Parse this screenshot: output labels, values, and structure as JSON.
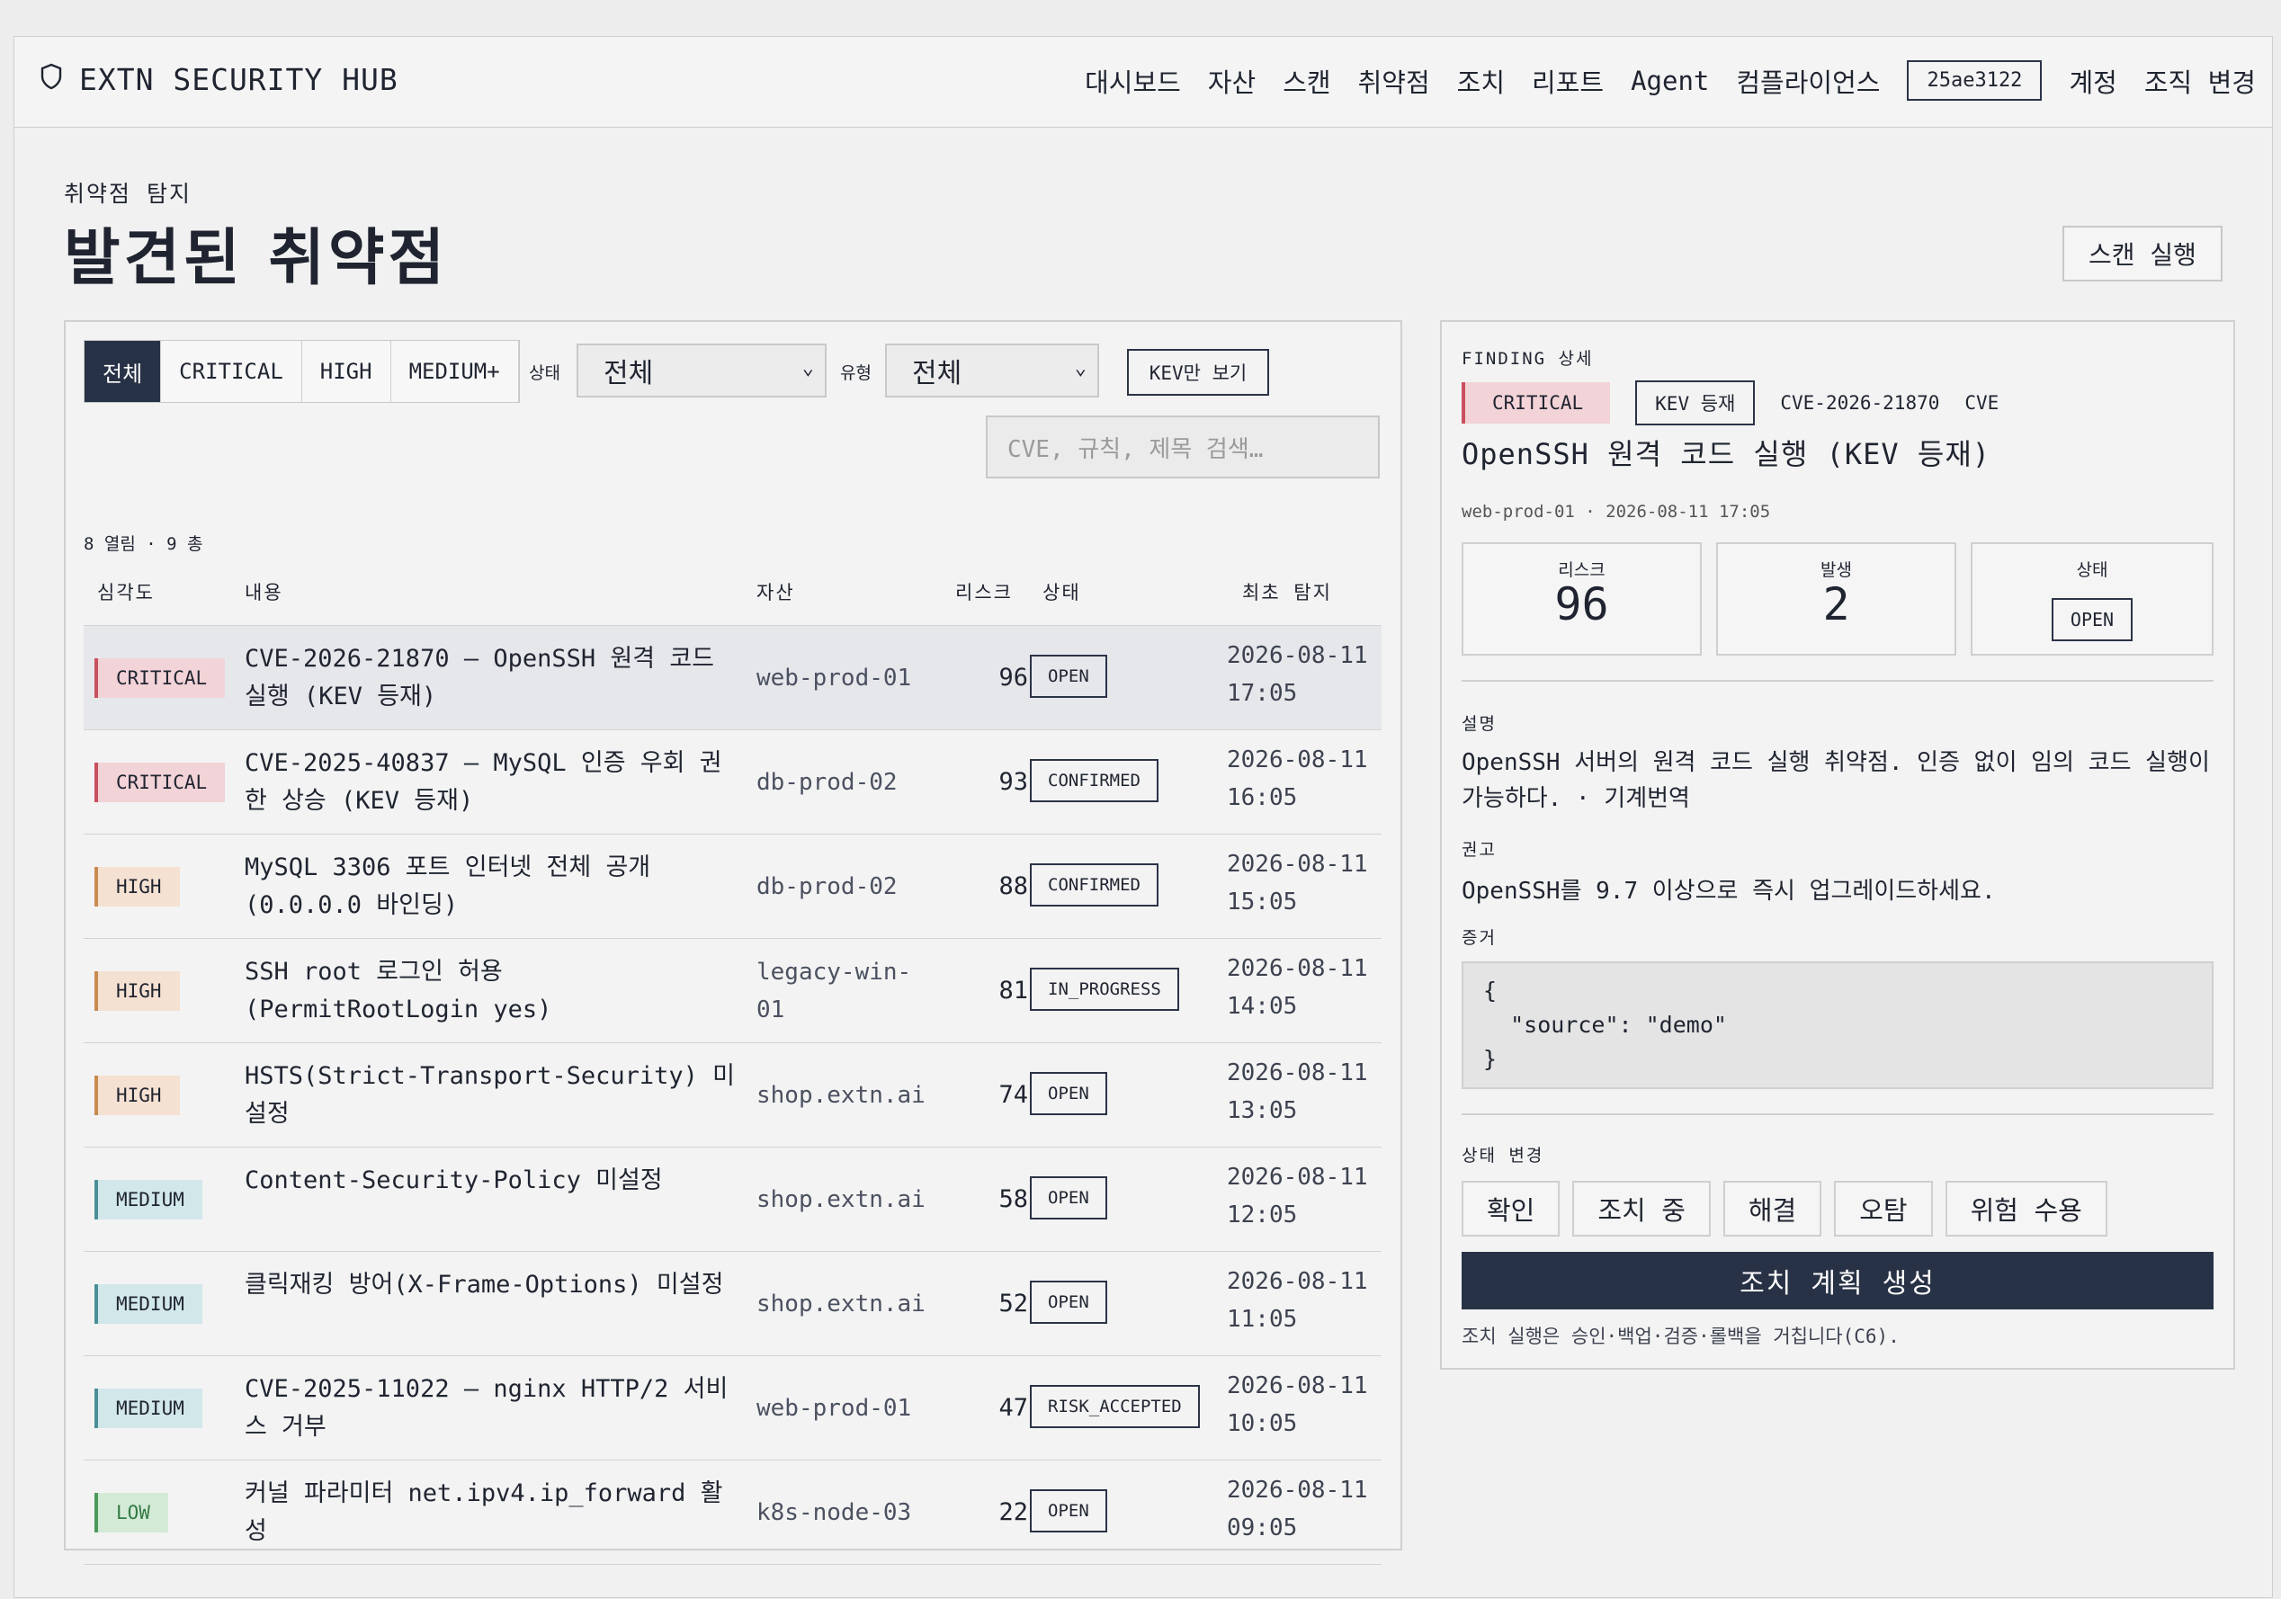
{
  "header": {
    "brand": "EXTN SECURITY HUB",
    "brand_icon": "shield-icon",
    "nav": [
      "대시보드",
      "자산",
      "스캔",
      "취약점",
      "조치",
      "리포트",
      "Agent",
      "컴플라이언스"
    ],
    "org_id": "25ae3122",
    "account": "계정",
    "switch_org": "조직 변경"
  },
  "page": {
    "kicker": "취약점 탐지",
    "title": "발견된 취약점",
    "scan_button": "스캔 실행"
  },
  "filters": {
    "severity_tabs": [
      "전체",
      "CRITICAL",
      "HIGH",
      "MEDIUM+"
    ],
    "active_tab": "전체",
    "status_label": "상태",
    "status_value": "전체",
    "type_label": "유형",
    "type_value": "전체",
    "kev_button": "KEV만 보기",
    "search_placeholder": "CVE, 규칙, 제목 검색…",
    "count_text": "8 열림 · 9 총"
  },
  "table": {
    "columns": [
      "심각도",
      "내용",
      "자산",
      "리스크",
      "상태",
      "최초 탐지"
    ],
    "rows": [
      {
        "severity": "CRITICAL",
        "title": "CVE-2026-21870 — OpenSSH 원격 코드 실행 (KEV 등재)",
        "asset": "web-prod-01",
        "risk": "96",
        "status": "OPEN",
        "date": "2026-08-11",
        "time": "17:05"
      },
      {
        "severity": "CRITICAL",
        "title": "CVE-2025-40837 — MySQL 인증 우회 권한 상승 (KEV 등재)",
        "asset": "db-prod-02",
        "risk": "93",
        "status": "CONFIRMED",
        "date": "2026-08-11",
        "time": "16:05"
      },
      {
        "severity": "HIGH",
        "title": "MySQL 3306 포트 인터넷 전체 공개 (0.0.0.0 바인딩)",
        "asset": "db-prod-02",
        "risk": "88",
        "status": "CONFIRMED",
        "date": "2026-08-11",
        "time": "15:05"
      },
      {
        "severity": "HIGH",
        "title": "SSH root 로그인 허용 (PermitRootLogin yes)",
        "asset": "legacy-win-01",
        "risk": "81",
        "status": "IN_PROGRESS",
        "date": "2026-08-11",
        "time": "14:05"
      },
      {
        "severity": "HIGH",
        "title": "HSTS(Strict-Transport-Security) 미설정",
        "asset": "shop.extn.ai",
        "risk": "74",
        "status": "OPEN",
        "date": "2026-08-11",
        "time": "13:05"
      },
      {
        "severity": "MEDIUM",
        "title": "Content-Security-Policy 미설정",
        "asset": "shop.extn.ai",
        "risk": "58",
        "status": "OPEN",
        "date": "2026-08-11",
        "time": "12:05"
      },
      {
        "severity": "MEDIUM",
        "title": "클릭재킹 방어(X-Frame-Options) 미설정",
        "asset": "shop.extn.ai",
        "risk": "52",
        "status": "OPEN",
        "date": "2026-08-11",
        "time": "11:05"
      },
      {
        "severity": "MEDIUM",
        "title": "CVE-2025-11022 — nginx HTTP/2 서비스 거부",
        "asset": "web-prod-01",
        "risk": "47",
        "status": "RISK_ACCEPTED",
        "date": "2026-08-11",
        "time": "10:05"
      },
      {
        "severity": "LOW",
        "title": "커널 파라미터 net.ipv4.ip_forward 활성",
        "asset": "k8s-node-03",
        "risk": "22",
        "status": "OPEN",
        "date": "2026-08-11",
        "time": "09:05"
      }
    ]
  },
  "detail": {
    "kicker": "FINDING 상세",
    "tags": {
      "severity": "CRITICAL",
      "kev": "KEV 등재",
      "cve": "CVE-2026-21870",
      "type": "CVE"
    },
    "title": "OpenSSH 원격 코드 실행 (KEV 등재)",
    "meta": "web-prod-01 · 2026-08-11 17:05",
    "stats": {
      "risk_label": "리스크",
      "risk_value": "96",
      "occ_label": "발생",
      "occ_value": "2",
      "status_label": "상태",
      "status_value": "OPEN"
    },
    "desc_label": "설명",
    "description": "OpenSSH 서버의 원격 코드 실행 취약점. 인증 없이 임의 코드 실행이 가능하다. · 기계번역",
    "advice_label": "권고",
    "advice": "OpenSSH를 9.7 이상으로 즉시 업그레이드하세요.",
    "evidence_label": "증거",
    "evidence": "{\n  \"source\": \"demo\"\n}",
    "status_change_label": "상태 변경",
    "status_actions": [
      "확인",
      "조치 중",
      "해결",
      "오탐",
      "위험 수용"
    ],
    "plan_button": "조치 계획 생성",
    "note": "조치 실행은 승인·백업·검증·롤백을 거칩니다(C6)."
  },
  "colors": {
    "primary": "#283246",
    "critical": "#c9505e",
    "high": "#c98a50",
    "medium": "#4a8f98",
    "low": "#4c9a5a"
  }
}
